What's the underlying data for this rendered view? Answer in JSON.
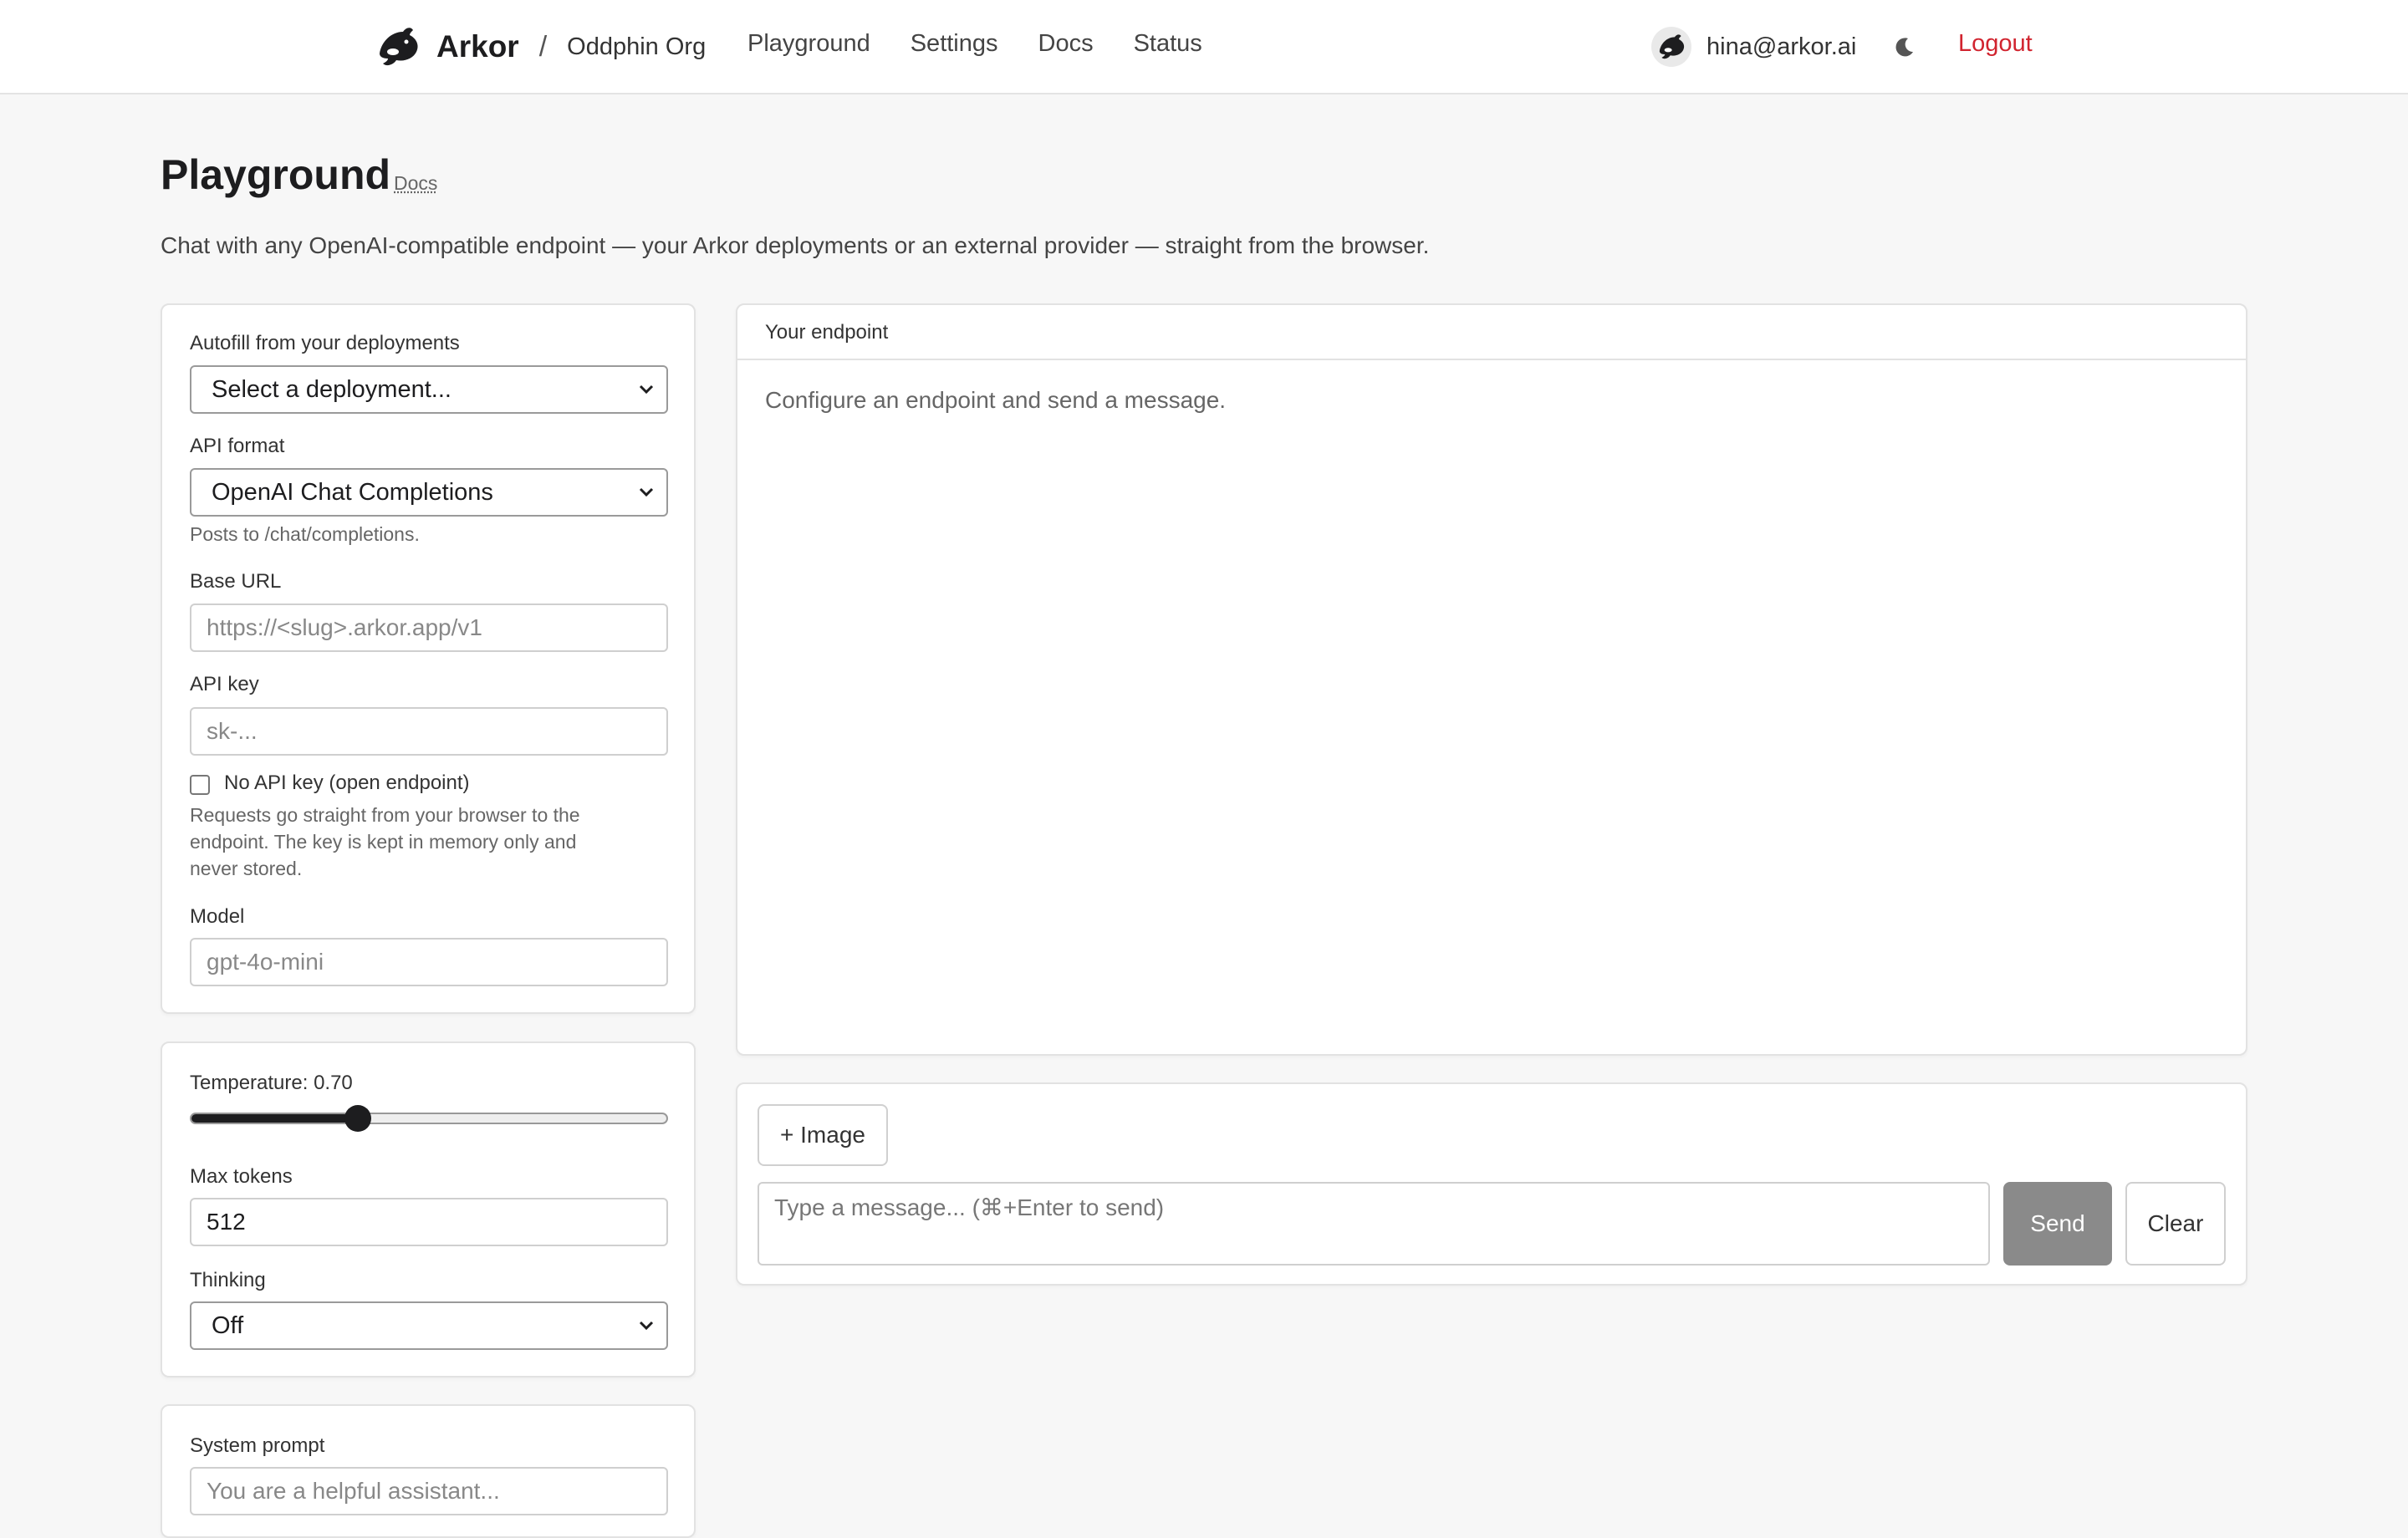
{
  "header": {
    "brand": "Arkor",
    "separator": "/",
    "org": "Oddphin Org",
    "nav": [
      "Playground",
      "Settings",
      "Docs",
      "Status"
    ],
    "user_email": "hina@arkor.ai",
    "logout_label": "Logout",
    "logout_color": "#d1242f",
    "theme_icon": "moon-icon"
  },
  "page": {
    "title": "Playground",
    "docs_link": "Docs",
    "subtitle": "Chat with any OpenAI-compatible endpoint — your Arkor deployments or an external provider — straight from the browser."
  },
  "config": {
    "autofill_label": "Autofill from your deployments",
    "autofill_value": "Select a deployment...",
    "api_format_label": "API format",
    "api_format_value": "OpenAI Chat Completions",
    "api_format_hint": "Posts to /chat/completions.",
    "base_url_label": "Base URL",
    "base_url_placeholder": "https://<slug>.arkor.app/v1",
    "api_key_label": "API key",
    "api_key_placeholder": "sk-...",
    "no_api_key_label": "No API key (open endpoint)",
    "no_api_key_checked": false,
    "privacy_note_lines": [
      "Requests go straight from your browser to the",
      "endpoint. The key is kept in memory only and",
      "never stored."
    ],
    "model_label": "Model",
    "model_placeholder": "gpt-4o-mini"
  },
  "params": {
    "temperature_label": "Temperature: 0.70",
    "temperature_value": 0.7,
    "temperature_min": 0,
    "temperature_max": 2,
    "max_tokens_label": "Max tokens",
    "max_tokens_value": "512",
    "thinking_label": "Thinking",
    "thinking_value": "Off"
  },
  "system": {
    "label": "System prompt",
    "placeholder": "You are a helpful assistant..."
  },
  "chat": {
    "endpoint_title": "Your endpoint",
    "empty_message": "Configure an endpoint and send a message.",
    "image_button": "+ Image",
    "message_placeholder": "Type a message... (⌘+Enter to send)",
    "send_label": "Send",
    "clear_label": "Clear"
  }
}
